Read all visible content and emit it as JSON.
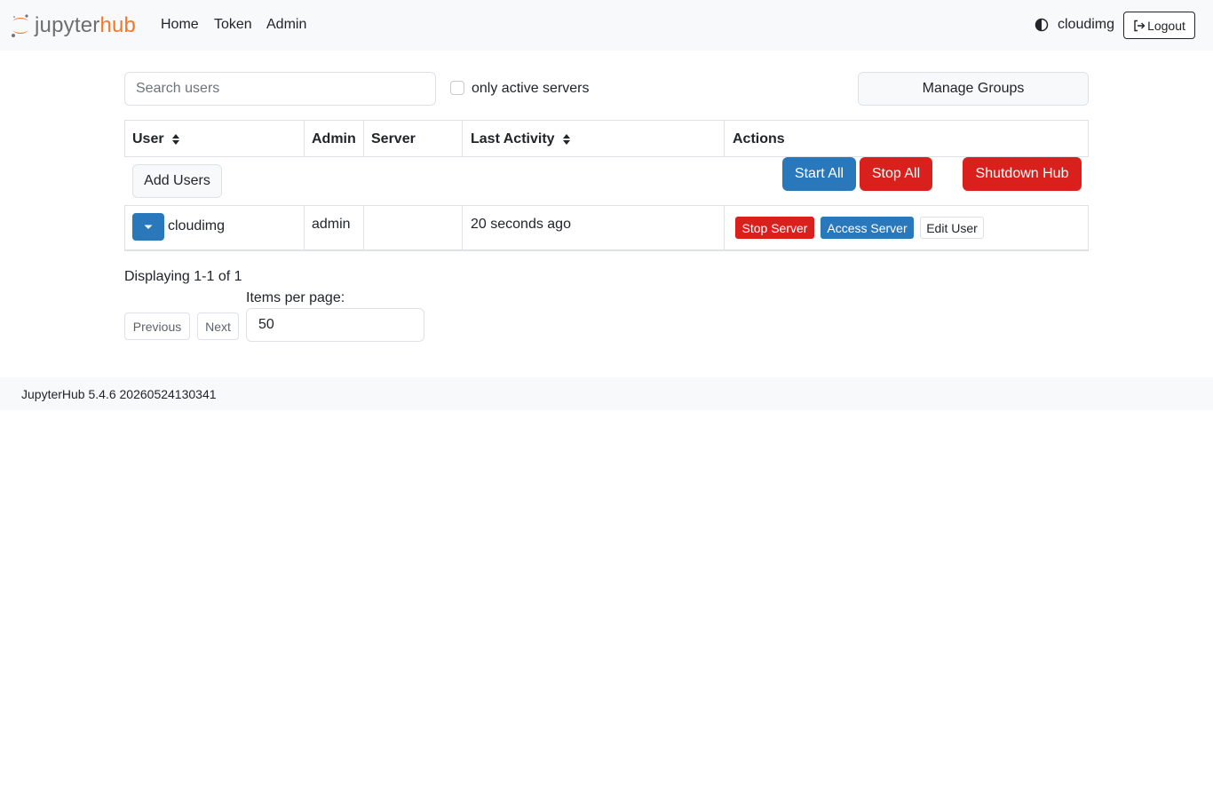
{
  "navbar": {
    "logo_jupyter": "jupyter",
    "logo_hub": "hub",
    "links": [
      "Home",
      "Token",
      "Admin"
    ],
    "theme_icon": "half-circle-contrast-icon",
    "username": "cloudimg",
    "logout_label": "Logout"
  },
  "controls": {
    "search_placeholder": "Search users",
    "active_only_label": "only active servers",
    "active_only_checked": false,
    "manage_groups_label": "Manage Groups"
  },
  "table": {
    "headers": [
      "User",
      "Admin",
      "Server",
      "Last Activity",
      "Actions"
    ],
    "add_users_label": "Add Users",
    "start_all_label": "Start All",
    "stop_all_label": "Stop All",
    "shutdown_hub_label": "Shutdown Hub",
    "rows": [
      {
        "user": "cloudimg",
        "admin": "admin",
        "server": "",
        "last_activity": "20 seconds ago",
        "stop_server_label": "Stop Server",
        "access_server_label": "Access Server",
        "edit_user_label": "Edit User"
      }
    ]
  },
  "pagination": {
    "displaying": "Displaying 1-1 of 1",
    "previous_label": "Previous",
    "next_label": "Next",
    "items_per_page_label": "Items per page:",
    "items_per_page_value": "50"
  },
  "footer": {
    "version": "JupyterHub 5.4.6 20260524130341"
  },
  "colors": {
    "primary": "#2a78bc",
    "danger": "#d9201d",
    "brand_orange": "#f37726",
    "navbar_bg": "#f8f9fa"
  }
}
